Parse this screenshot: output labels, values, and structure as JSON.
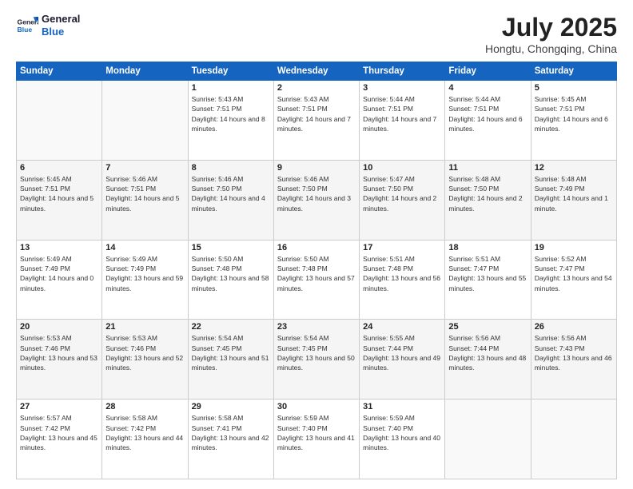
{
  "header": {
    "logo_line1": "General",
    "logo_line2": "Blue",
    "title": "July 2025",
    "subtitle": "Hongtu, Chongqing, China"
  },
  "columns": [
    "Sunday",
    "Monday",
    "Tuesday",
    "Wednesday",
    "Thursday",
    "Friday",
    "Saturday"
  ],
  "weeks": [
    [
      {
        "day": "",
        "sunrise": "",
        "sunset": "",
        "daylight": "",
        "empty": true
      },
      {
        "day": "",
        "sunrise": "",
        "sunset": "",
        "daylight": "",
        "empty": true
      },
      {
        "day": "1",
        "sunrise": "Sunrise: 5:43 AM",
        "sunset": "Sunset: 7:51 PM",
        "daylight": "Daylight: 14 hours and 8 minutes."
      },
      {
        "day": "2",
        "sunrise": "Sunrise: 5:43 AM",
        "sunset": "Sunset: 7:51 PM",
        "daylight": "Daylight: 14 hours and 7 minutes."
      },
      {
        "day": "3",
        "sunrise": "Sunrise: 5:44 AM",
        "sunset": "Sunset: 7:51 PM",
        "daylight": "Daylight: 14 hours and 7 minutes."
      },
      {
        "day": "4",
        "sunrise": "Sunrise: 5:44 AM",
        "sunset": "Sunset: 7:51 PM",
        "daylight": "Daylight: 14 hours and 6 minutes."
      },
      {
        "day": "5",
        "sunrise": "Sunrise: 5:45 AM",
        "sunset": "Sunset: 7:51 PM",
        "daylight": "Daylight: 14 hours and 6 minutes."
      }
    ],
    [
      {
        "day": "6",
        "sunrise": "Sunrise: 5:45 AM",
        "sunset": "Sunset: 7:51 PM",
        "daylight": "Daylight: 14 hours and 5 minutes."
      },
      {
        "day": "7",
        "sunrise": "Sunrise: 5:46 AM",
        "sunset": "Sunset: 7:51 PM",
        "daylight": "Daylight: 14 hours and 5 minutes."
      },
      {
        "day": "8",
        "sunrise": "Sunrise: 5:46 AM",
        "sunset": "Sunset: 7:50 PM",
        "daylight": "Daylight: 14 hours and 4 minutes."
      },
      {
        "day": "9",
        "sunrise": "Sunrise: 5:46 AM",
        "sunset": "Sunset: 7:50 PM",
        "daylight": "Daylight: 14 hours and 3 minutes."
      },
      {
        "day": "10",
        "sunrise": "Sunrise: 5:47 AM",
        "sunset": "Sunset: 7:50 PM",
        "daylight": "Daylight: 14 hours and 2 minutes."
      },
      {
        "day": "11",
        "sunrise": "Sunrise: 5:48 AM",
        "sunset": "Sunset: 7:50 PM",
        "daylight": "Daylight: 14 hours and 2 minutes."
      },
      {
        "day": "12",
        "sunrise": "Sunrise: 5:48 AM",
        "sunset": "Sunset: 7:49 PM",
        "daylight": "Daylight: 14 hours and 1 minute."
      }
    ],
    [
      {
        "day": "13",
        "sunrise": "Sunrise: 5:49 AM",
        "sunset": "Sunset: 7:49 PM",
        "daylight": "Daylight: 14 hours and 0 minutes."
      },
      {
        "day": "14",
        "sunrise": "Sunrise: 5:49 AM",
        "sunset": "Sunset: 7:49 PM",
        "daylight": "Daylight: 13 hours and 59 minutes."
      },
      {
        "day": "15",
        "sunrise": "Sunrise: 5:50 AM",
        "sunset": "Sunset: 7:48 PM",
        "daylight": "Daylight: 13 hours and 58 minutes."
      },
      {
        "day": "16",
        "sunrise": "Sunrise: 5:50 AM",
        "sunset": "Sunset: 7:48 PM",
        "daylight": "Daylight: 13 hours and 57 minutes."
      },
      {
        "day": "17",
        "sunrise": "Sunrise: 5:51 AM",
        "sunset": "Sunset: 7:48 PM",
        "daylight": "Daylight: 13 hours and 56 minutes."
      },
      {
        "day": "18",
        "sunrise": "Sunrise: 5:51 AM",
        "sunset": "Sunset: 7:47 PM",
        "daylight": "Daylight: 13 hours and 55 minutes."
      },
      {
        "day": "19",
        "sunrise": "Sunrise: 5:52 AM",
        "sunset": "Sunset: 7:47 PM",
        "daylight": "Daylight: 13 hours and 54 minutes."
      }
    ],
    [
      {
        "day": "20",
        "sunrise": "Sunrise: 5:53 AM",
        "sunset": "Sunset: 7:46 PM",
        "daylight": "Daylight: 13 hours and 53 minutes."
      },
      {
        "day": "21",
        "sunrise": "Sunrise: 5:53 AM",
        "sunset": "Sunset: 7:46 PM",
        "daylight": "Daylight: 13 hours and 52 minutes."
      },
      {
        "day": "22",
        "sunrise": "Sunrise: 5:54 AM",
        "sunset": "Sunset: 7:45 PM",
        "daylight": "Daylight: 13 hours and 51 minutes."
      },
      {
        "day": "23",
        "sunrise": "Sunrise: 5:54 AM",
        "sunset": "Sunset: 7:45 PM",
        "daylight": "Daylight: 13 hours and 50 minutes."
      },
      {
        "day": "24",
        "sunrise": "Sunrise: 5:55 AM",
        "sunset": "Sunset: 7:44 PM",
        "daylight": "Daylight: 13 hours and 49 minutes."
      },
      {
        "day": "25",
        "sunrise": "Sunrise: 5:56 AM",
        "sunset": "Sunset: 7:44 PM",
        "daylight": "Daylight: 13 hours and 48 minutes."
      },
      {
        "day": "26",
        "sunrise": "Sunrise: 5:56 AM",
        "sunset": "Sunset: 7:43 PM",
        "daylight": "Daylight: 13 hours and 46 minutes."
      }
    ],
    [
      {
        "day": "27",
        "sunrise": "Sunrise: 5:57 AM",
        "sunset": "Sunset: 7:42 PM",
        "daylight": "Daylight: 13 hours and 45 minutes."
      },
      {
        "day": "28",
        "sunrise": "Sunrise: 5:58 AM",
        "sunset": "Sunset: 7:42 PM",
        "daylight": "Daylight: 13 hours and 44 minutes."
      },
      {
        "day": "29",
        "sunrise": "Sunrise: 5:58 AM",
        "sunset": "Sunset: 7:41 PM",
        "daylight": "Daylight: 13 hours and 42 minutes."
      },
      {
        "day": "30",
        "sunrise": "Sunrise: 5:59 AM",
        "sunset": "Sunset: 7:40 PM",
        "daylight": "Daylight: 13 hours and 41 minutes."
      },
      {
        "day": "31",
        "sunrise": "Sunrise: 5:59 AM",
        "sunset": "Sunset: 7:40 PM",
        "daylight": "Daylight: 13 hours and 40 minutes."
      },
      {
        "day": "",
        "sunrise": "",
        "sunset": "",
        "daylight": "",
        "empty": true
      },
      {
        "day": "",
        "sunrise": "",
        "sunset": "",
        "daylight": "",
        "empty": true
      }
    ]
  ]
}
